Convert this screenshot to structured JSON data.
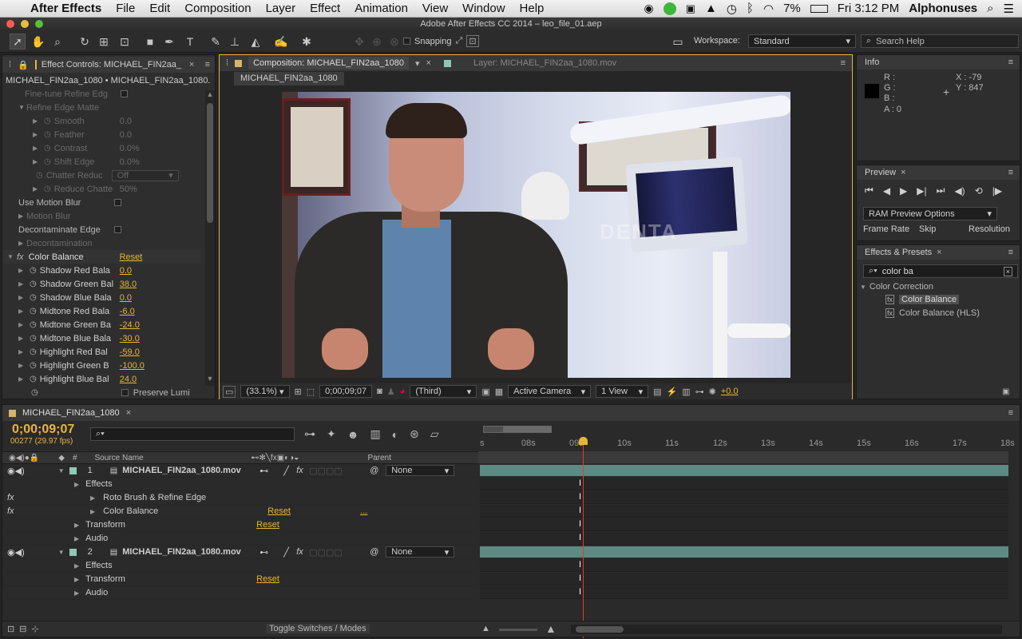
{
  "menubar": {
    "app": "After Effects",
    "items": [
      "File",
      "Edit",
      "Composition",
      "Layer",
      "Effect",
      "Animation",
      "View",
      "Window",
      "Help"
    ],
    "battery": "7%",
    "clock": "Fri 3:12 PM",
    "user": "Alphonuses"
  },
  "window": {
    "title": "Adobe After Effects CC 2014 – leo_file_01.aep"
  },
  "toolbar": {
    "snapping": "Snapping",
    "workspace_label": "Workspace:",
    "workspace_value": "Standard",
    "search_placeholder": "Search Help"
  },
  "effect_controls": {
    "tab": "Effect Controls: MICHAEL_FIN2aa_",
    "breadcrumb": "MICHAEL_FIN2aa_1080 • MICHAEL_FIN2aa_1080.",
    "rows": [
      {
        "label": "Fine-tune Refine Edg",
        "value": "",
        "dim": true
      },
      {
        "label": "Refine Edge Matte",
        "value": "",
        "dim": true
      },
      {
        "label": "Smooth",
        "value": "0.0",
        "dim": true
      },
      {
        "label": "Feather",
        "value": "0.0",
        "dim": true
      },
      {
        "label": "Contrast",
        "value": "0.0%",
        "dim": true
      },
      {
        "label": "Shift Edge",
        "value": "0.0%",
        "dim": true
      },
      {
        "label": "Chatter Reduc",
        "value": "Off",
        "dim": true
      },
      {
        "label": "Reduce Chatte",
        "value": "50%",
        "dim": true
      },
      {
        "label": "Use Motion Blur",
        "value": "",
        "dim": false
      },
      {
        "label": "Motion Blur",
        "value": "",
        "dim": true
      },
      {
        "label": "Decontaminate Edge",
        "value": "",
        "dim": false
      },
      {
        "label": "Decontamination",
        "value": "",
        "dim": true
      }
    ],
    "effect_name": "Color Balance",
    "reset": "Reset",
    "params": [
      {
        "label": "Shadow Red Bala",
        "value": "0.0"
      },
      {
        "label": "Shadow Green Bal",
        "value": "38.0"
      },
      {
        "label": "Shadow Blue Bala",
        "value": "0.0"
      },
      {
        "label": "Midtone Red Bala",
        "value": "-6.0"
      },
      {
        "label": "Midtone Green Ba",
        "value": "-24.0"
      },
      {
        "label": "Midtone Blue Bala",
        "value": "-30.0"
      },
      {
        "label": "Highlight Red Bal",
        "value": "-59.0"
      },
      {
        "label": "Highlight Green B",
        "value": "-100.0"
      },
      {
        "label": "Highlight Blue Bal",
        "value": "24.0"
      }
    ],
    "preserve": "Preserve Lumi"
  },
  "composition": {
    "tab": "Composition: MICHAEL_FIN2aa_1080",
    "layer_tab": "Layer: MICHAEL_FIN2aa_1080.mov",
    "sub_tab": "MICHAEL_FIN2aa_1080",
    "zoom": "(33.1%)",
    "timecode": "0;00;09;07",
    "resolution": "(Third)",
    "camera": "Active Camera",
    "view": "1 View",
    "exposure": "+0.0",
    "watermark": "DENTA"
  },
  "info": {
    "tab": "Info",
    "r": "R :",
    "g": "G :",
    "b": "B :",
    "a": "A : 0",
    "x": "X : -79",
    "y": "Y : 847"
  },
  "preview": {
    "tab": "Preview",
    "ram": "RAM Preview Options",
    "frame_rate": "Frame Rate",
    "skip": "Skip",
    "resolution": "Resolution"
  },
  "effects_presets": {
    "tab": "Effects & Presets",
    "search": "color ba",
    "category": "Color Correction",
    "items": [
      "Color Balance",
      "Color Balance (HLS)"
    ]
  },
  "timeline": {
    "tab": "MICHAEL_FIN2aa_1080",
    "timecode": "0;00;09;07",
    "frames": "00277 (29.97 fps)",
    "col_source": "Source Name",
    "col_parent": "Parent",
    "col_num": "#",
    "ticks": [
      "s",
      "08s",
      "09s",
      "10s",
      "11s",
      "12s",
      "13s",
      "14s",
      "15s",
      "16s",
      "17s",
      "18s"
    ],
    "rows": [
      {
        "kind": "layer",
        "num": "1",
        "name": "MICHAEL_FIN2aa_1080.mov",
        "parent": "None"
      },
      {
        "kind": "group",
        "name": "Effects"
      },
      {
        "kind": "effect",
        "name": "Roto Brush & Refine Edge"
      },
      {
        "kind": "effect",
        "name": "Color Balance",
        "reset": "Reset",
        "dots": "..."
      },
      {
        "kind": "group",
        "name": "Transform",
        "reset": "Reset"
      },
      {
        "kind": "group",
        "name": "Audio"
      },
      {
        "kind": "layer",
        "num": "2",
        "name": "MICHAEL_FIN2aa_1080.mov",
        "parent": "None"
      },
      {
        "kind": "group",
        "name": "Effects"
      },
      {
        "kind": "group",
        "name": "Transform",
        "reset": "Reset"
      },
      {
        "kind": "group",
        "name": "Audio"
      }
    ],
    "toggle": "Toggle Switches / Modes"
  }
}
